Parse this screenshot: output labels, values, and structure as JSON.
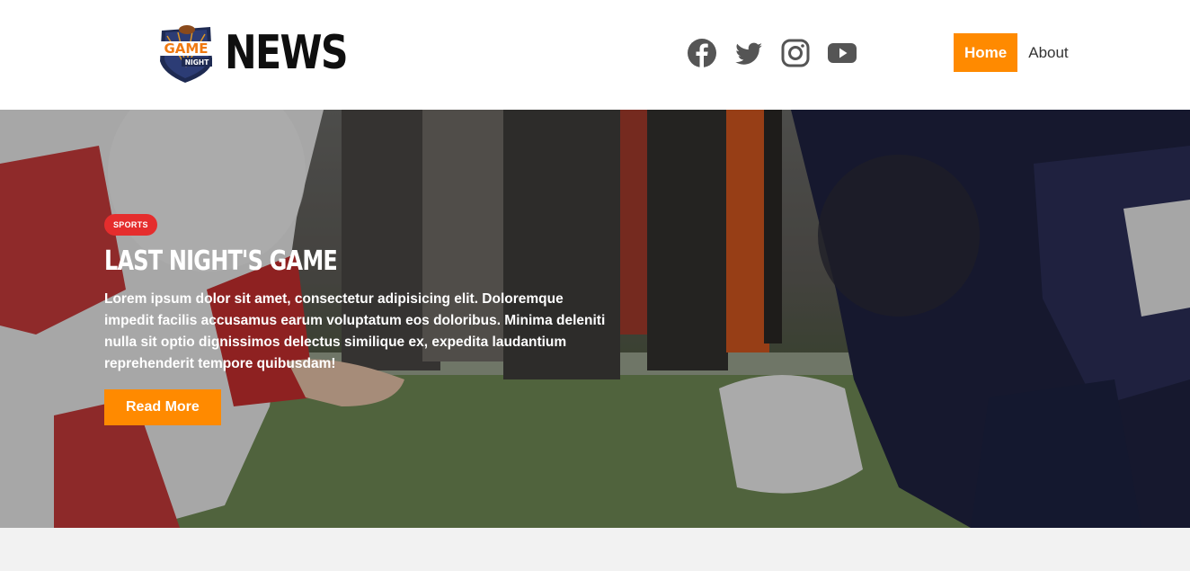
{
  "brand": {
    "logo_text_top": "GAME",
    "logo_text_bottom": "NIGHT",
    "wordmark": "NEWS"
  },
  "social": [
    {
      "icon": "facebook-icon"
    },
    {
      "icon": "twitter-icon"
    },
    {
      "icon": "instagram-icon"
    },
    {
      "icon": "youtube-icon"
    }
  ],
  "nav": {
    "items": [
      {
        "label": "Home",
        "active": true
      },
      {
        "label": "About",
        "active": false
      }
    ]
  },
  "hero": {
    "badge": "SPORTS",
    "title": "LAST NIGHT'S GAME",
    "body": "Lorem ipsum dolor sit amet, consectetur adipisicing elit. Doloremque impedit facilis accusamus earum voluptatum eos doloribus. Minima deleniti nulla sit optio dignissimos delectus similique ex, expedita laudantium reprehenderit tempore quibusdam!",
    "button": "Read More"
  },
  "colors": {
    "accent": "#ff8a00",
    "badge": "#e52d2d",
    "header_bg": "#ffffff",
    "page_bg": "#f2f2f2"
  }
}
